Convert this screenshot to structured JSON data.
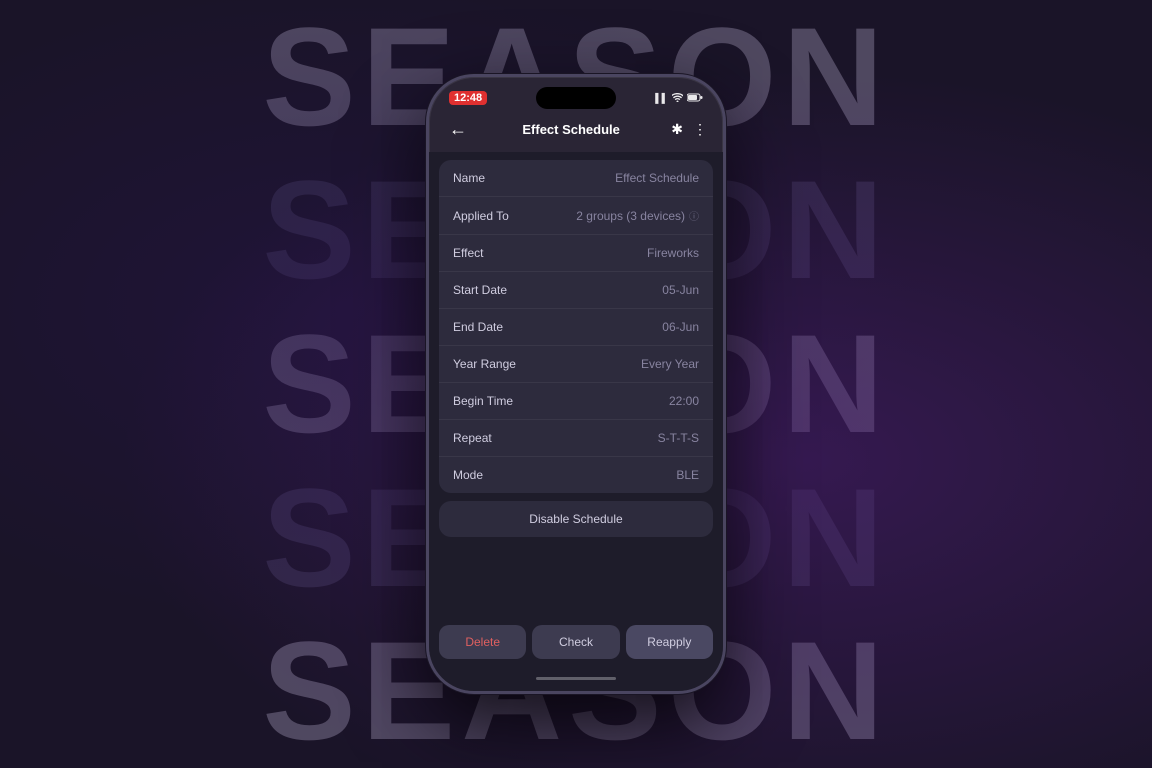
{
  "background": {
    "text_rows": [
      {
        "text": "SEASON",
        "style": "light"
      },
      {
        "text": "SEASON",
        "style": "dark"
      },
      {
        "text": "SEASON",
        "style": "light"
      },
      {
        "text": "SEASON",
        "style": "dark"
      },
      {
        "text": "SEASON",
        "style": "light"
      }
    ]
  },
  "phone": {
    "status_bar": {
      "time": "12:48",
      "signal": "▌▌",
      "wifi": "wifi",
      "battery": "battery"
    },
    "nav": {
      "back_icon": "←",
      "title": "Effect Schedule",
      "bluetooth_icon": "✱",
      "menu_icon": "⋮"
    },
    "rows": [
      {
        "label": "Name",
        "value": "Effect Schedule",
        "has_info": false
      },
      {
        "label": "Applied To",
        "value": "2 groups (3 devices)",
        "has_info": true
      },
      {
        "label": "Effect",
        "value": "Fireworks",
        "has_info": false
      },
      {
        "label": "Start Date",
        "value": "05-Jun",
        "has_info": false
      },
      {
        "label": "End Date",
        "value": "06-Jun",
        "has_info": false
      },
      {
        "label": "Year Range",
        "value": "Every Year",
        "has_info": false
      },
      {
        "label": "Begin Time",
        "value": "22:00",
        "has_info": false
      },
      {
        "label": "Repeat",
        "value": "S-T-T-S",
        "has_info": false
      },
      {
        "label": "Mode",
        "value": "BLE",
        "has_info": false
      }
    ],
    "disable_btn": "Disable Schedule",
    "actions": [
      {
        "label": "Delete",
        "type": "delete"
      },
      {
        "label": "Check",
        "type": "check"
      },
      {
        "label": "Reapply",
        "type": "reapply"
      }
    ]
  }
}
